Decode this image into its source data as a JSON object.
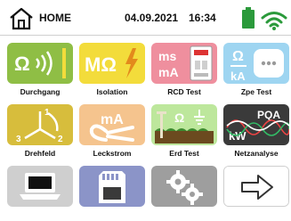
{
  "topbar": {
    "home_label": "HOME",
    "date": "04.09.2021",
    "time": "16:34",
    "battery_color": "#2b9a3b",
    "wifi_color": "#2b9a3b"
  },
  "tiles": {
    "durchgang": {
      "label": "Durchgang",
      "icon_text": "Ω",
      "color": "#8fbe45"
    },
    "isolation": {
      "label": "Isolation",
      "icon_text": "MΩ",
      "color": "#f3dc3b"
    },
    "rcd": {
      "label": "RCD Test",
      "line1": "ms",
      "line2": "mA",
      "color": "#ef8f9e"
    },
    "zpe": {
      "label": "Zpe Test",
      "icon_text": "Ω",
      "icon_text2": "kA",
      "color": "#9ed5f1"
    },
    "drehfeld": {
      "label": "Drehfeld",
      "n1": "1",
      "n2": "2",
      "n3": "3",
      "color": "#d7bd3c"
    },
    "leckstrom": {
      "label": "Leckstrom",
      "icon_text": "mA",
      "color": "#f5c48e"
    },
    "erd": {
      "label": "Erd Test",
      "icon_text": "Ω",
      "color": "#bde79c"
    },
    "netz": {
      "label": "Netzanalyse",
      "icon_text": "PQA",
      "icon_text2": "kW",
      "color": "#3a3a3a"
    },
    "computer": {
      "color": "#cfcfcf"
    },
    "memory": {
      "color": "#8b94c8"
    },
    "settings": {
      "color": "#9e9e9e"
    },
    "next": {
      "color": "#ffffff"
    }
  }
}
